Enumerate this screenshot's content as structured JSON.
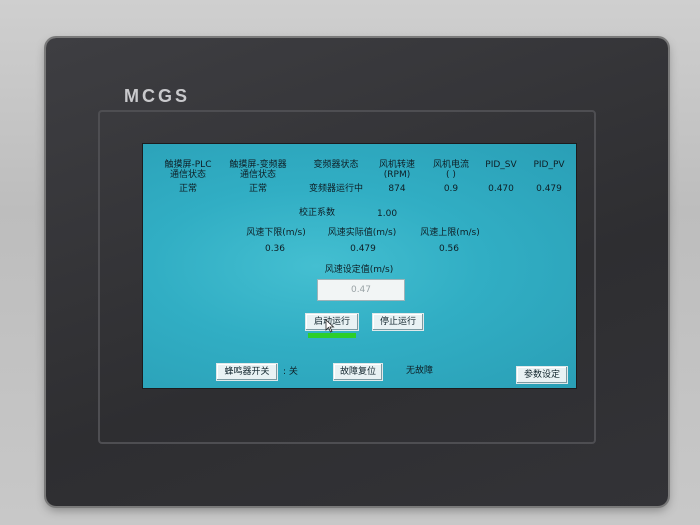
{
  "device": {
    "brand": "MCGS"
  },
  "header": {
    "col1_line1": "触摸屏-PLC",
    "col1_line2": "通信状态",
    "col2_line1": "触摸屏-变频器",
    "col2_line2": "通信状态",
    "col3": "变频器状态",
    "col4_line1": "风机转速",
    "col4_line2": "(RPM)",
    "col5_line1": "风机电流",
    "col5_line2": "( )",
    "col6": "PID_SV",
    "col7": "PID_PV"
  },
  "values": {
    "plc_comm": "正常",
    "vfd_comm": "正常",
    "vfd_state": "变频器运行中",
    "fan_speed": "874",
    "fan_current": "0.9",
    "pid_sv": "0.470",
    "pid_pv": "0.479"
  },
  "calibration": {
    "label": "校正系数",
    "value": "1.00"
  },
  "wind": {
    "lower_label": "风速下限(m/s)",
    "actual_label": "风速实际值(m/s)",
    "upper_label": "风速上限(m/s)",
    "lower_value": "0.36",
    "actual_value": "0.479",
    "upper_value": "0.56",
    "setpoint_label": "风速设定值(m/s)",
    "setpoint_value": "0.47"
  },
  "buttons": {
    "start": "启动运行",
    "stop": "停止运行",
    "buzzer": "蜂鸣器开关",
    "buzzer_state": ": 关",
    "fault_reset": "故障复位",
    "fault_status": "无故障",
    "params": "参数设定"
  },
  "colors": {
    "screen": "#31aec4",
    "run_indicator": "#2ccf2a",
    "bezel": "#333336"
  }
}
